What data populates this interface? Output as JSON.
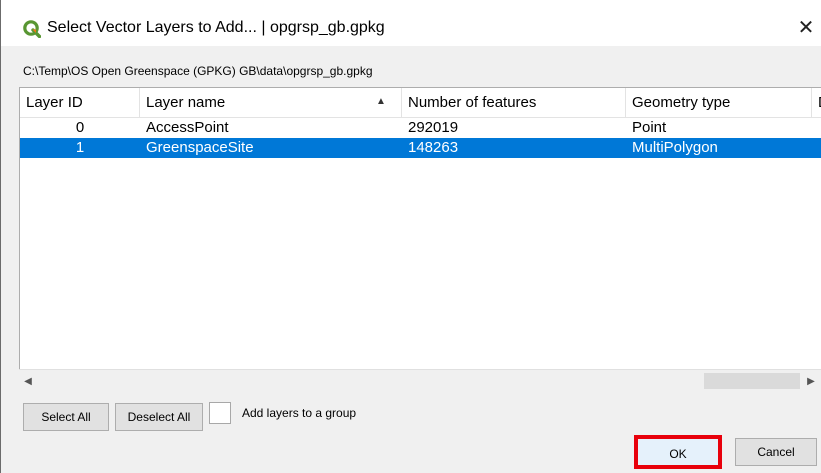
{
  "window": {
    "title": "Select Vector Layers to Add... | opgrsp_gb.gpkg",
    "close_glyph": "✕",
    "app_icon": "qgis-icon"
  },
  "path": "C:\\Temp\\OS Open Greenspace (GPKG) GB\\data\\opgrsp_gb.gpkg",
  "table": {
    "headers": [
      "Layer ID",
      "Layer name",
      "Number of features",
      "Geometry type",
      "D"
    ],
    "sort_indicator": "▲",
    "rows": [
      {
        "id": "0",
        "name": "AccessPoint",
        "features": "292019",
        "geometry": "Point",
        "selected": false
      },
      {
        "id": "1",
        "name": "GreenspaceSite",
        "features": "148263",
        "geometry": "MultiPolygon",
        "selected": true
      }
    ]
  },
  "scrollbar": {
    "left_arrow": "◀",
    "right_arrow": "▶"
  },
  "buttons": {
    "select_all": "Select All",
    "deselect_all": "Deselect All",
    "add_to_group": "Add layers to a group",
    "ok": "OK",
    "cancel": "Cancel"
  },
  "colors": {
    "selection": "#0078d7",
    "highlight_box": "#e8000b",
    "qgis_green": "#589632",
    "qgis_yellow": "#ee7913"
  }
}
